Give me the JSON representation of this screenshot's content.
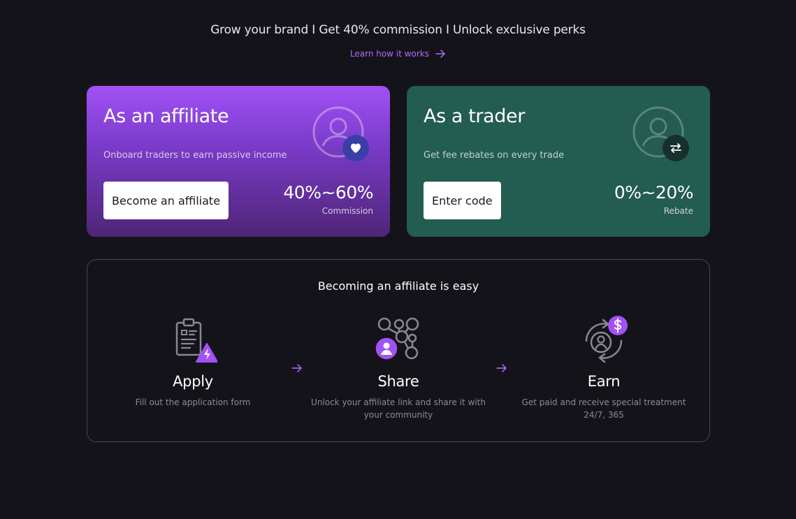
{
  "header": {
    "headline": "Grow your brand I Get 40% commission I Unlock exclusive perks",
    "learn_link": "Learn how it works"
  },
  "affiliate_card": {
    "title": "As an affiliate",
    "subtitle": "Onboard traders to earn passive income",
    "button": "Become an affiliate",
    "rate": "40%~60%",
    "rate_label": "Commission"
  },
  "trader_card": {
    "title": "As a trader",
    "subtitle": "Get fee rebates on every trade",
    "button": "Enter code",
    "rate": "0%~20%",
    "rate_label": "Rebate"
  },
  "steps": {
    "title": "Becoming an affiliate is easy",
    "items": [
      {
        "name": "Apply",
        "desc": "Fill out the application form",
        "icon": "clipboard-bolt-icon"
      },
      {
        "name": "Share",
        "desc": "Unlock your affiliate link and share it with your community",
        "icon": "network-user-icon"
      },
      {
        "name": "Earn",
        "desc": "Get paid and receive special treatment 24/7, 365",
        "icon": "dollar-cycle-icon"
      }
    ]
  },
  "colors": {
    "accent": "#b06cff",
    "affiliate_top": "#a251f6",
    "trader_bg": "#235c50",
    "page_bg": "#15131a"
  }
}
